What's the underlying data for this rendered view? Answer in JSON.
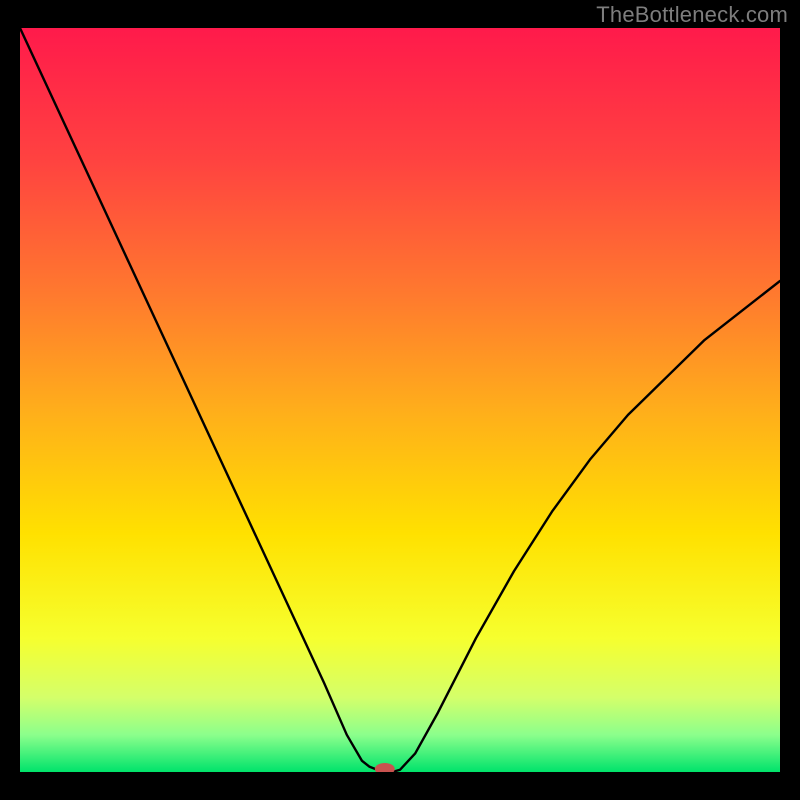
{
  "watermark": {
    "text": "TheBottleneck.com"
  },
  "chart_data": {
    "type": "line",
    "title": "",
    "xlabel": "",
    "ylabel": "",
    "xlim": [
      0,
      100
    ],
    "ylim": [
      0,
      100
    ],
    "grid": false,
    "legend": false,
    "background_gradient": {
      "stops": [
        {
          "offset": 0.0,
          "color": "#ff1a4b"
        },
        {
          "offset": 0.18,
          "color": "#ff4340"
        },
        {
          "offset": 0.36,
          "color": "#ff7a2e"
        },
        {
          "offset": 0.52,
          "color": "#ffb01a"
        },
        {
          "offset": 0.68,
          "color": "#ffe100"
        },
        {
          "offset": 0.82,
          "color": "#f6ff2e"
        },
        {
          "offset": 0.9,
          "color": "#d4ff6a"
        },
        {
          "offset": 0.95,
          "color": "#8cff8c"
        },
        {
          "offset": 1.0,
          "color": "#00e36b"
        }
      ]
    },
    "series": [
      {
        "name": "bottleneck-curve",
        "stroke": "#000000",
        "stroke_width": 2.4,
        "x": [
          0,
          5,
          10,
          15,
          20,
          25,
          30,
          35,
          40,
          43,
          45,
          46,
          47,
          48,
          49,
          50,
          52,
          55,
          60,
          65,
          70,
          75,
          80,
          85,
          90,
          95,
          100
        ],
        "y": [
          100,
          89,
          78,
          67,
          56,
          45,
          34,
          23,
          12,
          5.0,
          1.5,
          0.7,
          0.3,
          0.0,
          0.0,
          0.3,
          2.5,
          8.0,
          18,
          27,
          35,
          42,
          48,
          53,
          58,
          62,
          66
        ]
      }
    ],
    "marker": {
      "name": "min-marker",
      "x": 48,
      "y": 0,
      "color": "#c8524f",
      "rx": 10,
      "ry": 6
    }
  }
}
